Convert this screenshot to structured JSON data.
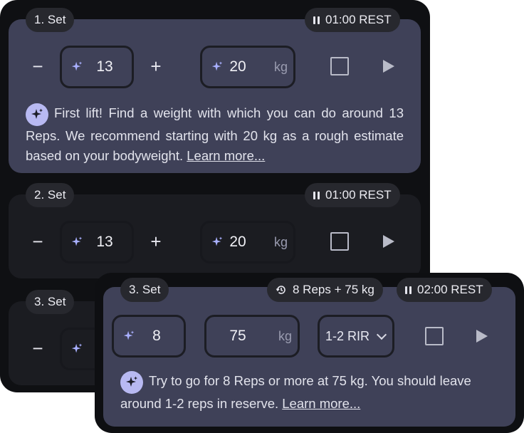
{
  "sets": [
    {
      "label": "1. Set",
      "rest": "01:00 REST",
      "reps": "13",
      "weight": "20",
      "unit": "kg",
      "hint": "First lift! Find a weight with which you can do around 13 Reps. We recommend starting with 20 kg as a rough estimate based on your bodyweight.",
      "link": "Learn more..."
    },
    {
      "label": "2. Set",
      "rest": "01:00 REST",
      "reps": "13",
      "weight": "20",
      "unit": "kg"
    },
    {
      "label": "3. Set"
    }
  ],
  "focus_set": {
    "label": "3. Set",
    "previous": "8 Reps + 75 kg",
    "rest": "02:00 REST",
    "reps": "8",
    "weight": "75",
    "unit": "kg",
    "rir": "1-2 RIR",
    "hint": "Try to go for 8 Reps or more at 75 kg. You should leave around 1-2 reps in reserve.",
    "link": "Learn more..."
  },
  "controls": {
    "minus": "−",
    "plus": "+"
  },
  "colors": {
    "active_card": "#3f4158",
    "dim_card": "#1b1c21",
    "accent": "#b8b9f2"
  },
  "icons": [
    "sparkle-icon",
    "pause-icon",
    "history-icon",
    "checkbox-icon",
    "play-icon",
    "chevron-down-icon"
  ]
}
